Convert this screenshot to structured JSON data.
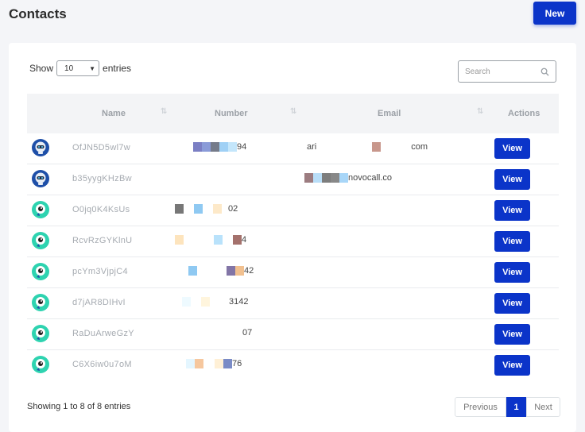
{
  "header": {
    "title": "Contacts",
    "new_label": "New"
  },
  "controls": {
    "show_label": "Show",
    "entries_value": "10",
    "entries_label": "entries",
    "search_placeholder": "Search"
  },
  "table": {
    "columns": [
      "Name",
      "Number",
      "Email",
      "Actions"
    ],
    "rows": [
      {
        "name": "OfJN5D5wl7w",
        "number_tail": "94",
        "email_head": "ari",
        "email_tail": "com",
        "avatar": "robot-avatar-blue",
        "action": "View"
      },
      {
        "name": "b35yygKHzBw",
        "number_tail": "",
        "email_head": "",
        "email_tail": "novocall.co",
        "avatar": "robot-avatar-blue",
        "action": "View"
      },
      {
        "name": "O0jq0K4KsUs",
        "number_tail": "02",
        "email_head": "",
        "email_tail": "",
        "avatar": "chat-avatar-teal",
        "action": "View"
      },
      {
        "name": "RcvRzGYKlnU",
        "number_tail": "4",
        "email_head": "",
        "email_tail": "",
        "avatar": "chat-avatar-teal",
        "action": "View"
      },
      {
        "name": "pcYm3VjpjC4",
        "number_tail": "42",
        "email_head": "",
        "email_tail": "",
        "avatar": "chat-avatar-teal",
        "action": "View"
      },
      {
        "name": "d7jAR8DIHvI",
        "number_tail": "3142",
        "email_head": "",
        "email_tail": "",
        "avatar": "chat-avatar-teal",
        "action": "View"
      },
      {
        "name": "RaDuArweGzY",
        "number_tail": "07",
        "email_head": "",
        "email_tail": "",
        "avatar": "chat-avatar-teal",
        "action": "View"
      },
      {
        "name": "C6X6iw0u7oM",
        "number_tail": "76",
        "email_head": "",
        "email_tail": "",
        "avatar": "chat-avatar-teal",
        "action": "View"
      }
    ]
  },
  "footer": {
    "showing": "Showing 1 to 8 of 8 entries",
    "previous": "Previous",
    "current_page": "1",
    "next": "Next"
  },
  "colors": {
    "accent": "#0b34c9",
    "teal": "#2ed3b0"
  }
}
